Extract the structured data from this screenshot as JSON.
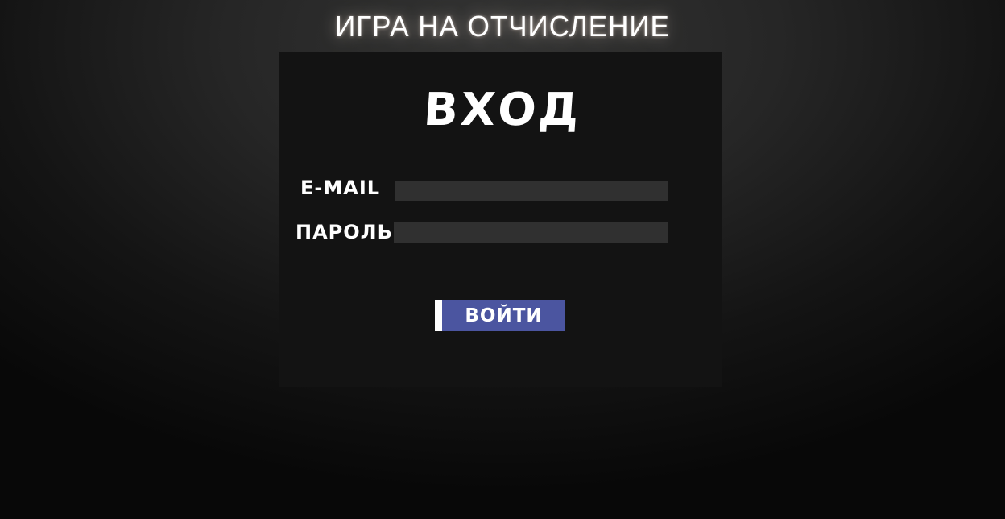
{
  "site": {
    "title": "ИГРА НА ОТЧИСЛЕНИЕ"
  },
  "login_form": {
    "heading": "ВХОД",
    "email_label": "E-MAIL",
    "email_value": "",
    "password_label": "ПАРОЛЬ",
    "password_value": "",
    "submit_label": "ВОЙТИ"
  },
  "colors": {
    "panel_background": "#131313",
    "input_background": "#303030",
    "button_background": "#4b55a0",
    "button_accent": "#ffffff",
    "text": "#ffffff"
  }
}
